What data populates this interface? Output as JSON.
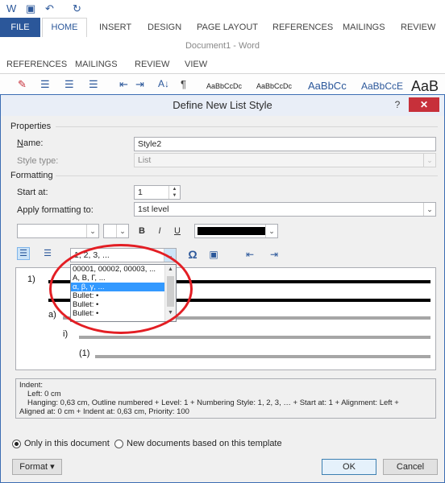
{
  "word": {
    "tabs": [
      "FILE",
      "HOME",
      "INSERT",
      "DESIGN",
      "PAGE LAYOUT",
      "REFERENCES",
      "MAILINGS",
      "REVIEW"
    ],
    "doc_title": "Document1 - Word",
    "tabs2": [
      "REFERENCES",
      "MAILINGS",
      "REVIEW",
      "VIEW"
    ],
    "style_samples": [
      "AaBbCcDc",
      "AaBbCcDc",
      "AaBbCc",
      "AaBbCcE",
      "AaB"
    ]
  },
  "dialog": {
    "title": "Define New List Style",
    "help": "?",
    "close": "✕",
    "properties_label": "Properties",
    "name_label": "Name:",
    "name_value": "Style2",
    "style_type_label": "Style type:",
    "style_type_value": "List",
    "formatting_label": "Formatting",
    "start_at_label": "Start at:",
    "start_at_value": "1",
    "apply_to_label": "Apply formatting to:",
    "apply_to_value": "1st level",
    "toolbar": {
      "bold": "B",
      "italic": "I",
      "underline": "U",
      "numbering_value": "1, 2, 3, ...",
      "symbol": "Ω"
    },
    "numbering_options": [
      "00001, 00002, 00003, ...",
      "A, B, Γ, ...",
      "α, β, γ, ...",
      "Bullet: •",
      "Bullet: •",
      "Bullet: •"
    ],
    "selected_option_index": 2,
    "preview_labels": [
      "1)",
      "a)",
      "i)",
      "(1)"
    ],
    "description": {
      "line1": "Indent:",
      "line2": "Left:  0 cm",
      "line3": "Hanging:  0,63 cm, Outline numbered + Level: 1 + Numbering Style: 1, 2, 3, … + Start at: 1 + Alignment: Left +",
      "line4": "Aligned at:  0 cm + Indent at:  0,63 cm, Priority: 100"
    },
    "radio_only_doc": "Only in this document",
    "radio_new_docs": "New documents based on this template",
    "format_button": "Format ▾",
    "ok_button": "OK",
    "cancel_button": "Cancel",
    "colors": {
      "accent": "#2b579a",
      "close": "#c7303a",
      "selection": "#3399ff",
      "annotation": "#e31e24"
    }
  }
}
